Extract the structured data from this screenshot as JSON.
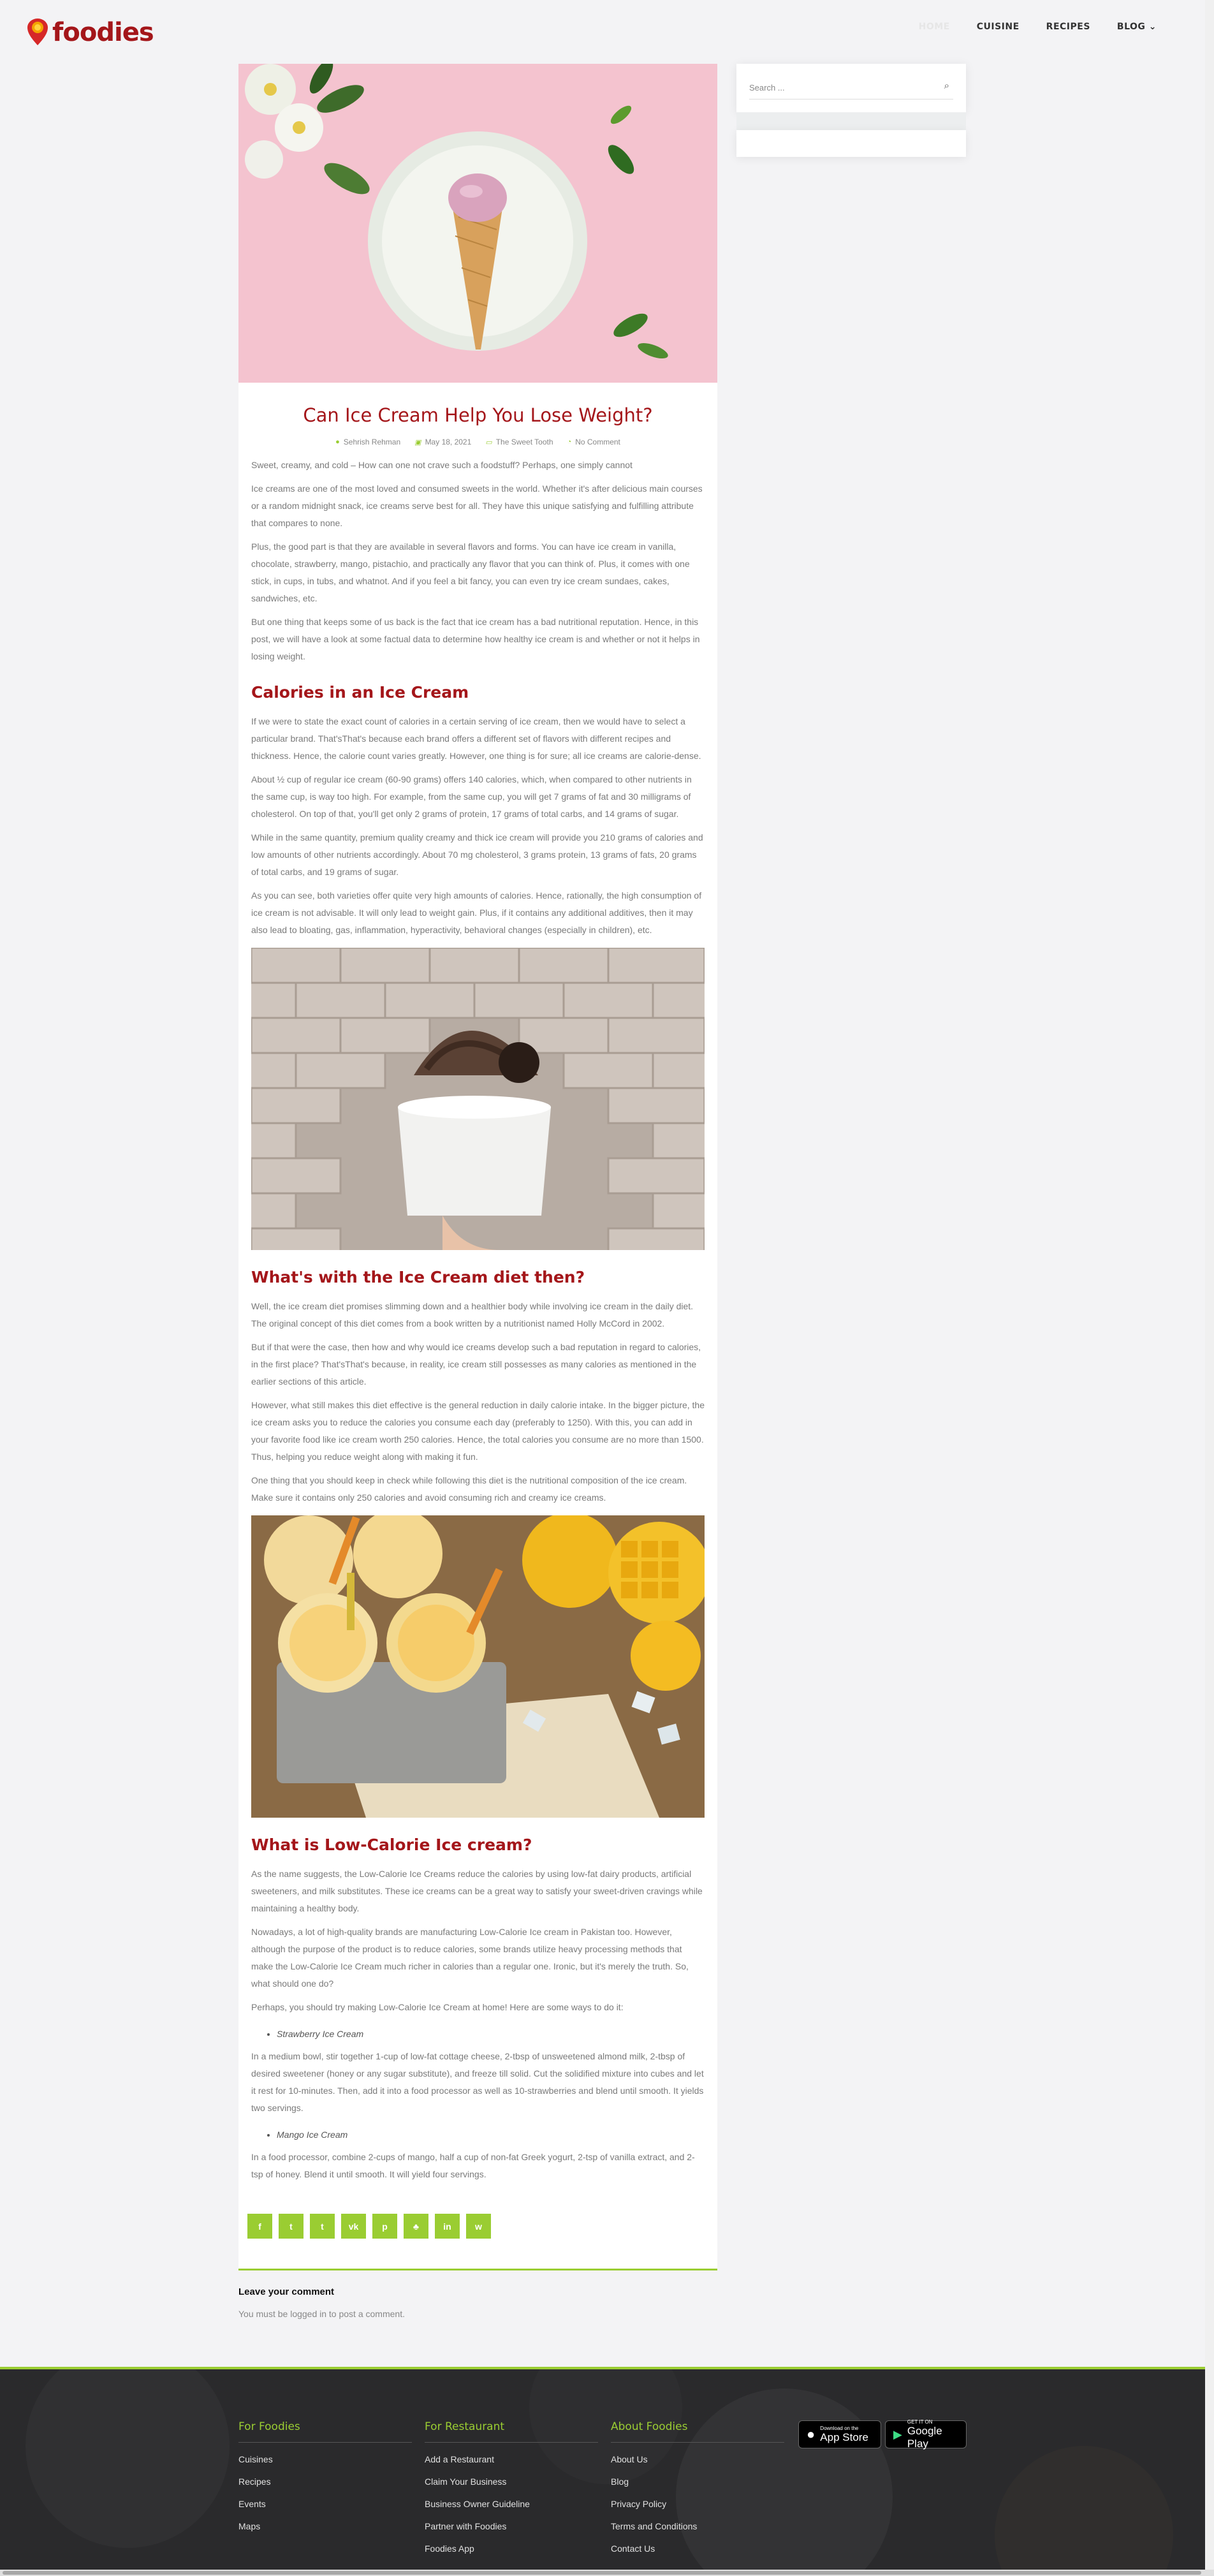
{
  "header": {
    "logo_text": "foodies",
    "nav": [
      {
        "label": "Home",
        "faded": true
      },
      {
        "label": "Cuisine"
      },
      {
        "label": "Recipes"
      },
      {
        "label": "Blog ⌄"
      }
    ]
  },
  "article": {
    "title": "Can Ice Cream Help You Lose Weight?",
    "meta": {
      "author": "Sehrish Rehman",
      "date": "May 18, 2021",
      "category": "The Sweet Tooth",
      "comments": "No Comment"
    },
    "intro": [
      "Sweet, creamy, and cold – How can one not crave such a foodstuff? Perhaps, one simply cannot",
      "Ice creams are one of the most loved and consumed sweets in the world. Whether it's after delicious main courses or a random midnight snack, ice creams serve best for all. They have this unique satisfying and fulfilling attribute that compares to none.",
      "Plus, the good part is that they are available in several flavors and forms. You can have ice cream in vanilla, chocolate, strawberry, mango, pistachio, and practically any flavor that you can think of. Plus, it comes with one stick, in cups, in tubs, and whatnot. And if you feel a bit fancy, you can even try ice cream sundaes, cakes, sandwiches, etc.",
      "But one thing that keeps some of us back is the fact that ice cream has a bad nutritional reputation. Hence, in this post, we will have a look at some factual data to determine how healthy ice cream is and whether or not it helps in losing weight."
    ],
    "section1": {
      "heading": "Calories in an Ice Cream",
      "paragraphs": [
        "If we were to state the exact count of calories in a certain serving of ice cream, then we would have to select a particular brand. That'sThat's because each brand offers a different set of flavors with different recipes and thickness. Hence, the calorie count varies greatly. However, one thing is for sure; all ice creams are calorie-dense.",
        "About ½ cup of regular ice cream (60-90 grams) offers 140 calories, which, when compared to other nutrients in the same cup, is way too high. For example, from the same cup, you will get 7 grams of fat and 30 milligrams of cholesterol. On top of that, you'll get only 2 grams of protein, 17 grams of total carbs, and 14 grams of sugar.",
        " While in the same quantity, premium quality creamy and thick ice cream will provide you 210 grams of calories and low amounts of other nutrients accordingly. About 70 mg cholesterol, 3 grams protein, 13 grams of fats, 20 grams of total carbs, and 19 grams of sugar.",
        "As you can see, both varieties offer quite very high amounts of calories. Hence, rationally, the high consumption of ice cream is not advisable. It will only lead to weight gain. Plus, if it contains any additional additives, then it may also lead to bloating, gas, inflammation, hyperactivity, behavioral changes (especially in children), etc."
      ]
    },
    "section2": {
      "heading": "What's with the Ice Cream diet then?",
      "paragraphs": [
        "Well, the ice cream diet promises slimming down and a healthier body while involving ice cream in the daily diet. The original concept of this diet comes from a book written by a nutritionist named Holly McCord in 2002.",
        "But if that were the case, then how and why would ice creams develop such a bad reputation in regard to calories, in the first place? That'sThat's because, in reality, ice cream still possesses as many calories as mentioned in the earlier sections of this article.",
        "However, what still makes this diet effective is the general reduction in daily calorie intake. In the bigger picture, the ice cream asks you to reduce the calories you consume each day (preferably to 1250). With this, you can add in your favorite food like ice cream worth 250 calories. Hence, the total calories you consume are no more than 1500. Thus, helping you reduce weight along with making it fun.",
        "One thing that you should keep in check while following this diet is the nutritional composition of the ice cream. Make sure it contains only 250 calories and avoid consuming rich and creamy ice creams."
      ]
    },
    "section3": {
      "heading": "What is Low-Calorie Ice cream?",
      "paragraphs": [
        "As the name suggests, the Low-Calorie Ice Creams reduce the calories by using low-fat dairy products, artificial sweeteners, and milk substitutes. These ice creams can be a great way to satisfy your sweet-driven cravings while maintaining a healthy body.",
        "Nowadays, a lot of high-quality brands are manufacturing Low-Calorie Ice cream in Pakistan too. However, although the purpose of the product is to reduce calories, some brands utilize heavy processing methods that make the Low-Calorie Ice Cream much richer in calories than a regular one. Ironic, but it's merely the truth. So, what should one do?",
        "Perhaps, you should try making Low-Calorie Ice Cream at home! Here are some ways to do it:"
      ],
      "recipe1_title": "Strawberry Ice Cream",
      "recipe1_text": "In a medium bowl, stir together 1-cup of low-fat cottage cheese, 2-tbsp of unsweetened almond milk, 2-tbsp of desired sweetener (honey or any sugar substitute), and freeze till solid. Cut the solidified mixture into cubes and let it rest for 10-minutes. Then, add it into a food processor as well as 10-strawberries and blend until smooth. It yields two servings.",
      "recipe2_title": "Mango Ice Cream",
      "recipe2_text": "In a food processor, combine 2-cups of mango, half a cup of non-fat Greek yogurt, 2-tsp of vanilla extract, and 2-tsp of honey. Blend it until smooth. It will yield four servings."
    },
    "share_icons": [
      "f",
      "t",
      "t",
      "vk",
      "p",
      "♣",
      "in",
      "w"
    ]
  },
  "comment": {
    "heading": "Leave your comment",
    "text": "You must be logged in to post a comment."
  },
  "sidebar": {
    "search_placeholder": "Search ..."
  },
  "footer": {
    "col1": {
      "title": "For Foodies",
      "links": [
        "Cuisines",
        "Recipes",
        "Events",
        "Maps"
      ]
    },
    "col2": {
      "title": "For Restaurant",
      "links": [
        "Add a Restaurant",
        "Claim Your Business",
        "Business Owner Guideline",
        "Partner with Foodies",
        "Foodies App"
      ]
    },
    "col3": {
      "title": "About Foodies",
      "links": [
        "About Us",
        "Blog",
        "Privacy Policy",
        "Terms and Conditions",
        "Contact Us"
      ]
    },
    "appstore": {
      "small": "Download on the",
      "big": "App Store"
    },
    "googleplay": {
      "small": "GET IT ON",
      "big": "Google Play"
    }
  },
  "colors": {
    "accent": "#9acd32",
    "heading": "#a4161a",
    "footer_bg": "#2a2a2c"
  }
}
